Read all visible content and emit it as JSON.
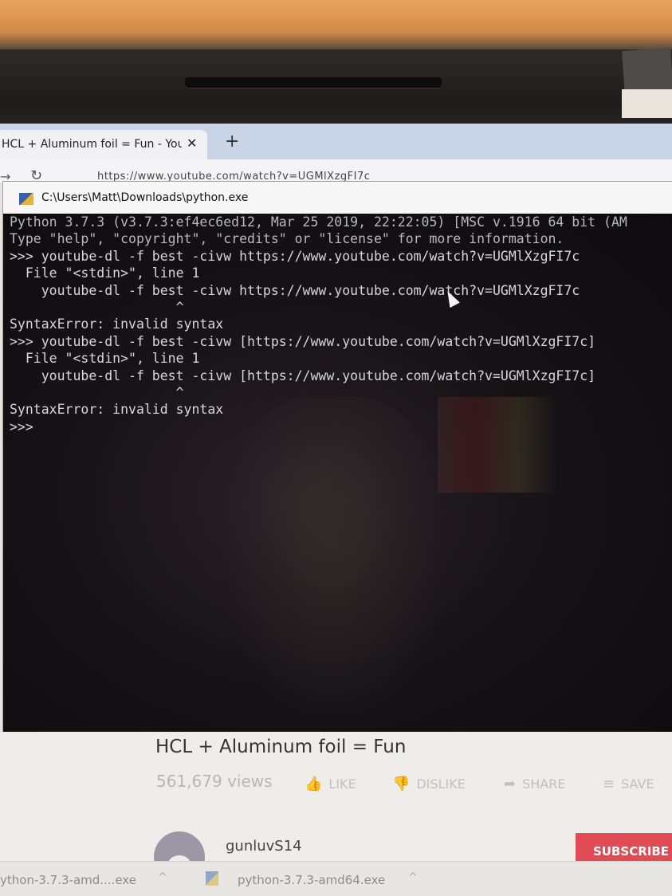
{
  "browser": {
    "tab_title": "HCL + Aluminum foil = Fun - You",
    "tab_close": "✕",
    "new_tab": "+",
    "url": "https://www.youtube.com/watch?v=UGMlXzgFI7c"
  },
  "console": {
    "title": "C:\\Users\\Matt\\Downloads\\python.exe",
    "lines": [
      "Python 3.7.3 (v3.7.3:ef4ec6ed12, Mar 25 2019, 22:22:05) [MSC v.1916 64 bit (AM",
      "Type \"help\", \"copyright\", \"credits\" or \"license\" for more information.",
      ">>> youtube-dl -f best -civw https://www.youtube.com/watch?v=UGMlXzgFI7c",
      "  File \"<stdin>\", line 1",
      "    youtube-dl -f best -civw https://www.youtube.com/watch?v=UGMlXzgFI7c",
      "                     ^",
      "SyntaxError: invalid syntax",
      ">>> youtube-dl -f best -civw [https://www.youtube.com/watch?v=UGMlXzgFI7c]",
      "  File \"<stdin>\", line 1",
      "    youtube-dl -f best -civw [https://www.youtube.com/watch?v=UGMlXzgFI7c]",
      "                     ^",
      "SyntaxError: invalid syntax",
      ">>>"
    ]
  },
  "video": {
    "title": "HCL + Aluminum foil = Fun",
    "views": "561,679 views",
    "like_label": "LIKE",
    "dislike_label": "DISLIKE",
    "share_label": "SHARE",
    "save_label": "SAVE",
    "channel": "gunluvS14",
    "subscribe_label": "SUBSCRIBE"
  },
  "downloads": {
    "item1": "ython-3.7.3-amd....exe",
    "item2": "python-3.7.3-amd64.exe",
    "chevron": "^"
  },
  "icons": {
    "like": "thumbs-up-icon",
    "dislike": "thumbs-down-icon",
    "share": "share-arrow-icon",
    "save": "playlist-add-icon",
    "cursor": "mouse-pointer-icon"
  }
}
